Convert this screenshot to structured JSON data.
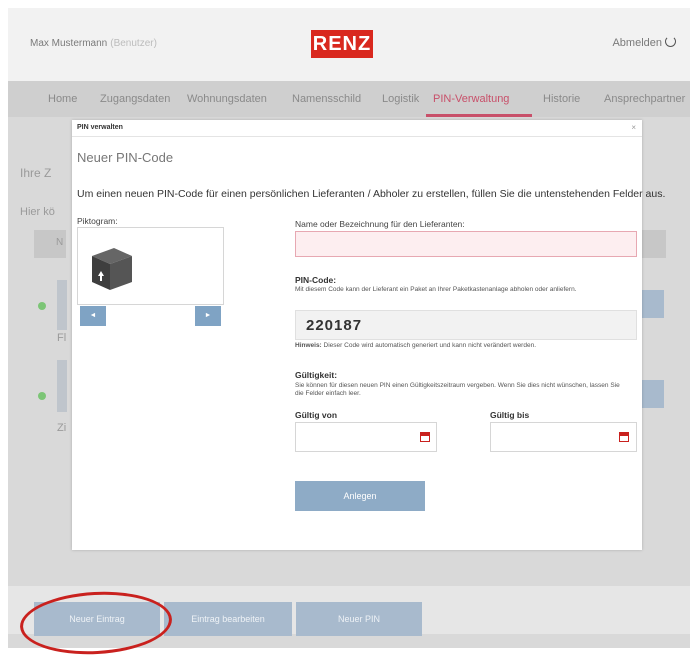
{
  "header": {
    "user_name": "Max Mustermann",
    "user_role": "(Benutzer)",
    "logo": "RENZ",
    "logout": "Abmelden"
  },
  "nav": {
    "tabs": [
      "Home",
      "Zugangsdaten",
      "Wohnungsdaten",
      "Namensschild",
      "Logistik",
      "PIN-Verwaltung",
      "Historie",
      "Ansprechpartner"
    ],
    "active_tab": "PIN-Verwaltung"
  },
  "background": {
    "title_partial": "Ihre Z",
    "text_partial": "Hier kö",
    "col_partial": "N",
    "row1_partial": "Fl",
    "row2_partial": "Zi"
  },
  "footer": {
    "buttons": [
      "Neuer Eintrag",
      "Eintrag bearbeiten",
      "Neuer PIN"
    ]
  },
  "modal": {
    "title": "PIN verwalten",
    "close": "×",
    "heading": "Neuer PIN-Code",
    "intro": "Um einen neuen PIN-Code für einen persönlichen Lieferanten / Abholer zu erstellen, füllen Sie die untenstehenden Felder aus.",
    "pictogram_label": "Piktogram:",
    "prev": "◄",
    "next": "►",
    "name_label": "Name oder Bezeichnung für den Lieferanten:",
    "name_value": "",
    "pin_label": "PIN-Code:",
    "pin_desc": "Mit diesem Code kann der Lieferant ein Paket an Ihrer Paketkastenanlage abholen oder anliefern.",
    "pin_value": "220187",
    "pin_hint_bold": "Hinweis:",
    "pin_hint": "Dieser Code wird automatisch generiert und kann nicht verändert werden.",
    "validity_label": "Gültigkeit:",
    "validity_desc": "Sie können für diesen neuen PIN einen Gültigkeitszeitraum vergeben. Wenn Sie dies nicht wünschen, lassen Sie die Felder einfach leer.",
    "valid_from_label": "Gültig von",
    "valid_to_label": "Gültig bis",
    "valid_from_value": "",
    "valid_to_value": "",
    "submit": "Anlegen"
  }
}
